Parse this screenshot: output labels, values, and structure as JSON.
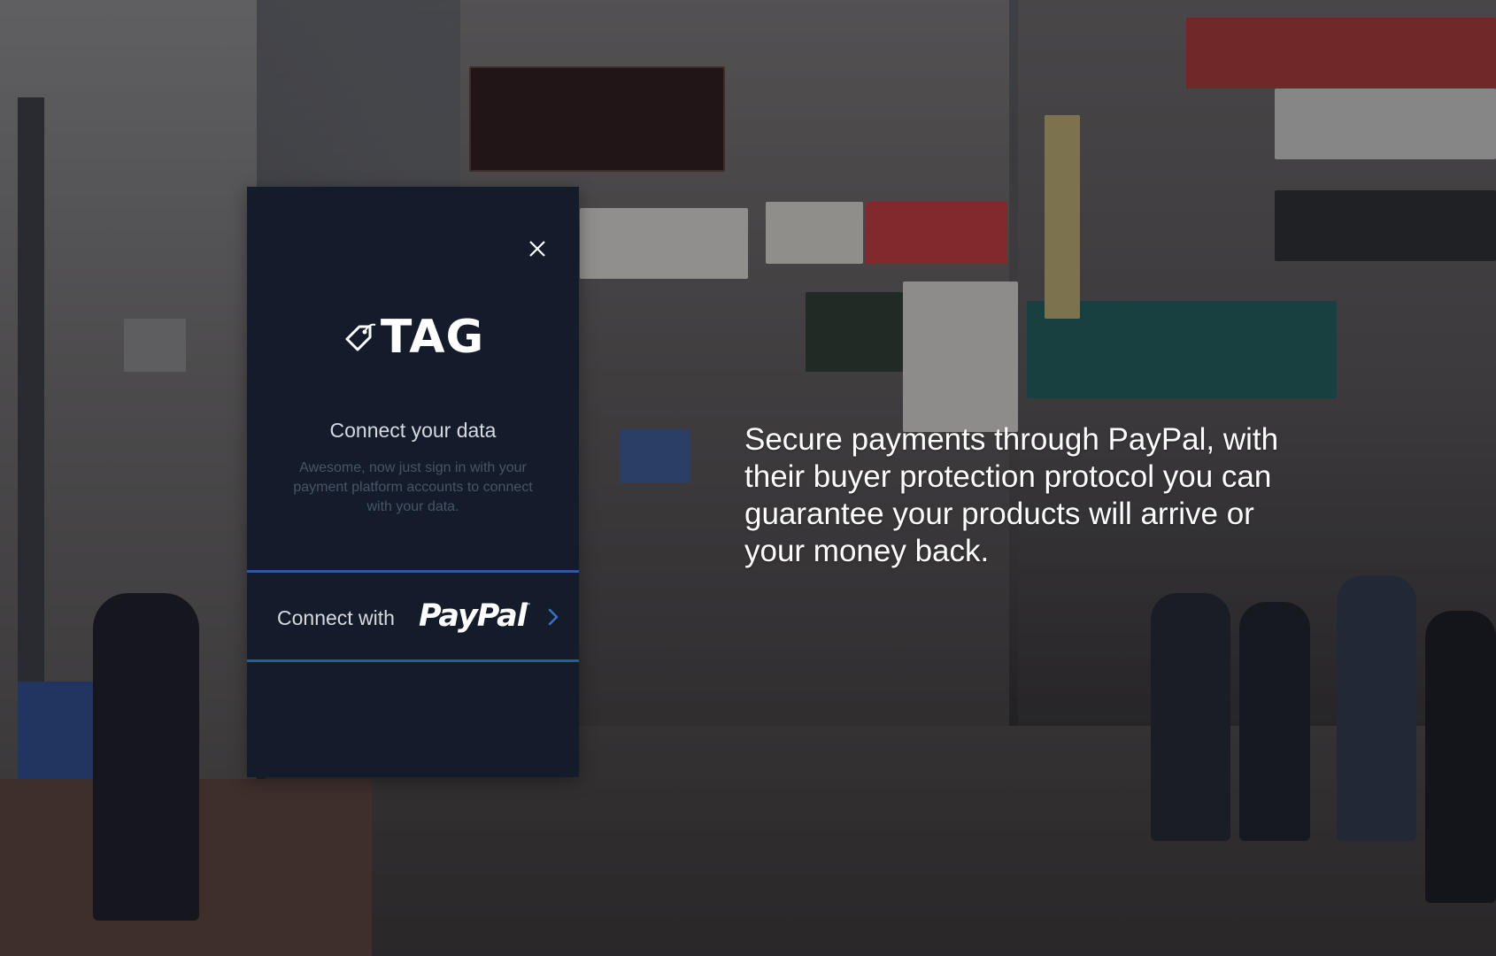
{
  "panel": {
    "logo_text": "TAG",
    "title": "Connect your data",
    "description": "Awesome, now just sign in with your payment platform accounts to connect with your data.",
    "connect_label": "Connect with",
    "provider_name": "PayPal",
    "provider_tm": "™"
  },
  "hero": {
    "text": "Secure payments through PayPal, with their buyer protection protocol you can guarantee your products will arrive or your money back."
  },
  "icons": {
    "close": "close-icon",
    "tag": "tag-icon",
    "chevron": "chevron-right-icon"
  },
  "colors": {
    "panel_bg": "#141c2b",
    "accent_line": "#2b5aa0",
    "chevron": "#3b6fc0"
  }
}
